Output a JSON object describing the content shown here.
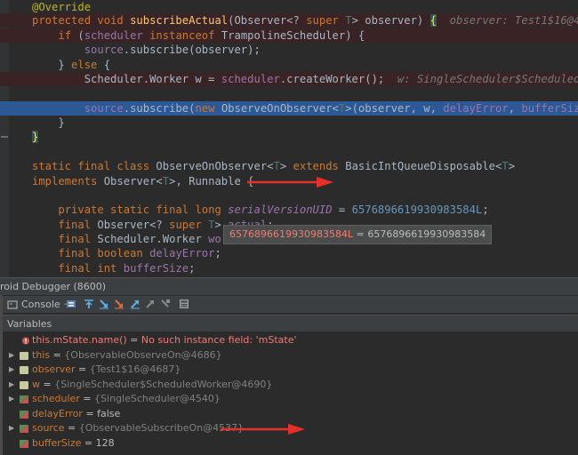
{
  "editor": {
    "lines": [
      {
        "code": "@Override"
      },
      {
        "code": "protected void subscribeActual(Observer<? super T> observer) {",
        "hint": "observer: Test1$16@4687"
      },
      {
        "code": "if (scheduler instanceof TrampolineScheduler) {"
      },
      {
        "code": "source.subscribe(observer);"
      },
      {
        "code": "} else {"
      },
      {
        "code": "Scheduler.Worker w = scheduler.createWorker();",
        "hint": "w: SingleScheduler$ScheduledWorker"
      },
      {
        "code": ""
      },
      {
        "code": "source.subscribe(new ObserveOnObserver<T>(observer, w, delayError, bufferSize));"
      },
      {
        "code": "}"
      },
      {
        "code": "}"
      },
      {
        "code": ""
      },
      {
        "code": "static final class ObserveOnObserver<T> extends BasicIntQueueDisposable<T>"
      },
      {
        "code": "implements Observer<T>, Runnable {"
      },
      {
        "code": ""
      },
      {
        "code": "private static final long serialVersionUID = 6576896619930983584L;"
      },
      {
        "code": "final Observer<? super T> actual;"
      },
      {
        "code": "final Scheduler.Worker worker;"
      },
      {
        "code": "final boolean delayError;"
      },
      {
        "code": "final int bufferSize;"
      }
    ]
  },
  "tooltip": {
    "key": "6576896619930983584L",
    "rest": " = 6576896619930983584"
  },
  "debugger": {
    "title": "roid Debugger (8600)",
    "console_tab": "Console",
    "variables_label": "Variables",
    "variables": [
      {
        "name": "this.mState.name()",
        "value": "No such instance field: 'mState'",
        "kind": "error"
      },
      {
        "name": "this",
        "value": "{ObservableObserveOn@4686}",
        "kind": "object"
      },
      {
        "name": "observer",
        "value": "{Test1$16@4687}",
        "kind": "object"
      },
      {
        "name": "w",
        "value": "{SingleScheduler$ScheduledWorker@4690}",
        "kind": "object"
      },
      {
        "name": "scheduler",
        "value": "{SingleScheduler@4540}",
        "kind": "object"
      },
      {
        "name": "delayError",
        "value": "false",
        "kind": "primitive"
      },
      {
        "name": "source",
        "value": "{ObservableSubscribeOn@4537}",
        "kind": "object"
      },
      {
        "name": "bufferSize",
        "value": "128",
        "kind": "primitive"
      }
    ]
  },
  "colors": {
    "editor_bg": "#2b2b2b",
    "keyword": "#cc7832",
    "field": "#9876aa",
    "number": "#6897bb",
    "exec_line": "#2d5896",
    "arrow": "#e8302a"
  },
  "icons": [
    "breakpoint-icon",
    "expand-arrow-icon",
    "field-icon",
    "step-over-icon",
    "step-into-icon",
    "step-out-icon",
    "console-icon",
    "settings-icon"
  ]
}
